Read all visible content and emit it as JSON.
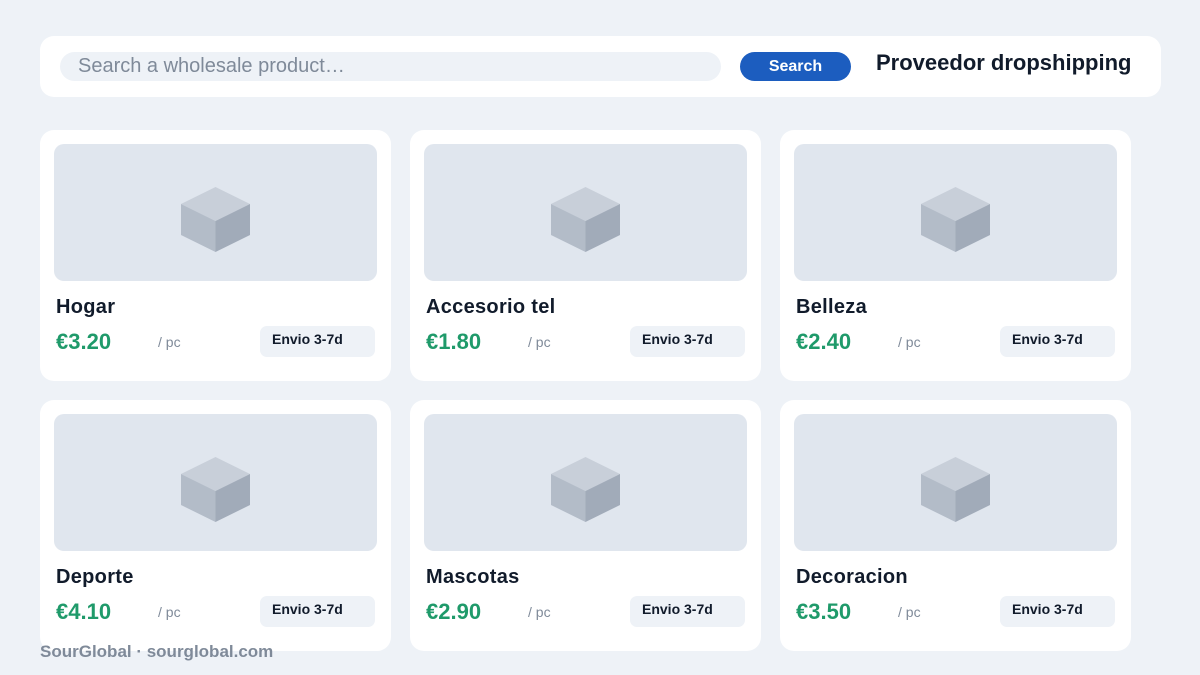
{
  "search": {
    "placeholder": "Search a wholesale product…",
    "value": "",
    "button_label": "Search"
  },
  "header": {
    "title": "Proveedor dropshipping"
  },
  "products": [
    {
      "name": "Hogar",
      "price": "€3.20",
      "unit": "/ pc",
      "shipping": "Envio 3-7d",
      "image_icon": "box-icon"
    },
    {
      "name": "Accesorio tel",
      "price": "€1.80",
      "unit": "/ pc",
      "shipping": "Envio 3-7d",
      "image_icon": "box-icon"
    },
    {
      "name": "Belleza",
      "price": "€2.40",
      "unit": "/ pc",
      "shipping": "Envio 3-7d",
      "image_icon": "box-icon"
    },
    {
      "name": "Deporte",
      "price": "€4.10",
      "unit": "/ pc",
      "shipping": "Envio 3-7d",
      "image_icon": "box-icon"
    },
    {
      "name": "Mascotas",
      "price": "€2.90",
      "unit": "/ pc",
      "shipping": "Envio 3-7d",
      "image_icon": "box-icon"
    },
    {
      "name": "Decoracion",
      "price": "€3.50",
      "unit": "/ pc",
      "shipping": "Envio 3-7d",
      "image_icon": "box-icon"
    }
  ],
  "footer": {
    "text": "SourGlobal · sourglobal.com"
  },
  "colors": {
    "accent": "#1c5dbf",
    "price": "#1f9a6a",
    "background": "#eef2f7",
    "card": "#ffffff",
    "placeholder_image": "#e0e6ee"
  }
}
